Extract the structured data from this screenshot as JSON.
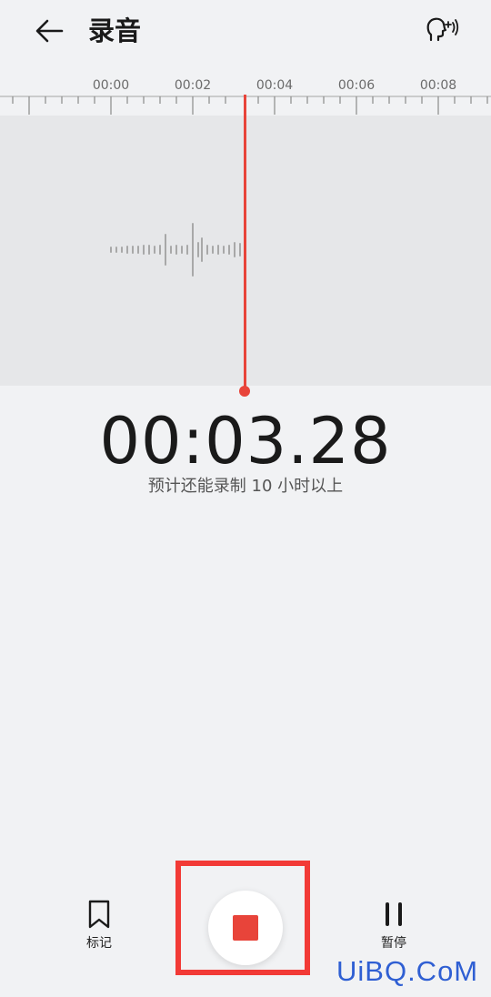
{
  "header": {
    "title": "录音",
    "back_icon": "arrow-left-icon",
    "voice_icon": "voice-enhance-icon"
  },
  "timeline": {
    "labels": [
      "00:00",
      "00:02",
      "00:04",
      "00:06",
      "00:08"
    ]
  },
  "timer": {
    "elapsed": "00:03.28",
    "remaining": "预计还能录制 10 小时以上"
  },
  "controls": {
    "mark_label": "标记",
    "pause_label": "暂停",
    "mark_icon": "bookmark-icon",
    "stop_icon": "stop-icon",
    "pause_icon": "pause-icon"
  },
  "colors": {
    "accent": "#e8443a",
    "highlight": "#f23a36",
    "watermark": "#2f5fd3"
  },
  "watermark": "UiBQ.CoM"
}
